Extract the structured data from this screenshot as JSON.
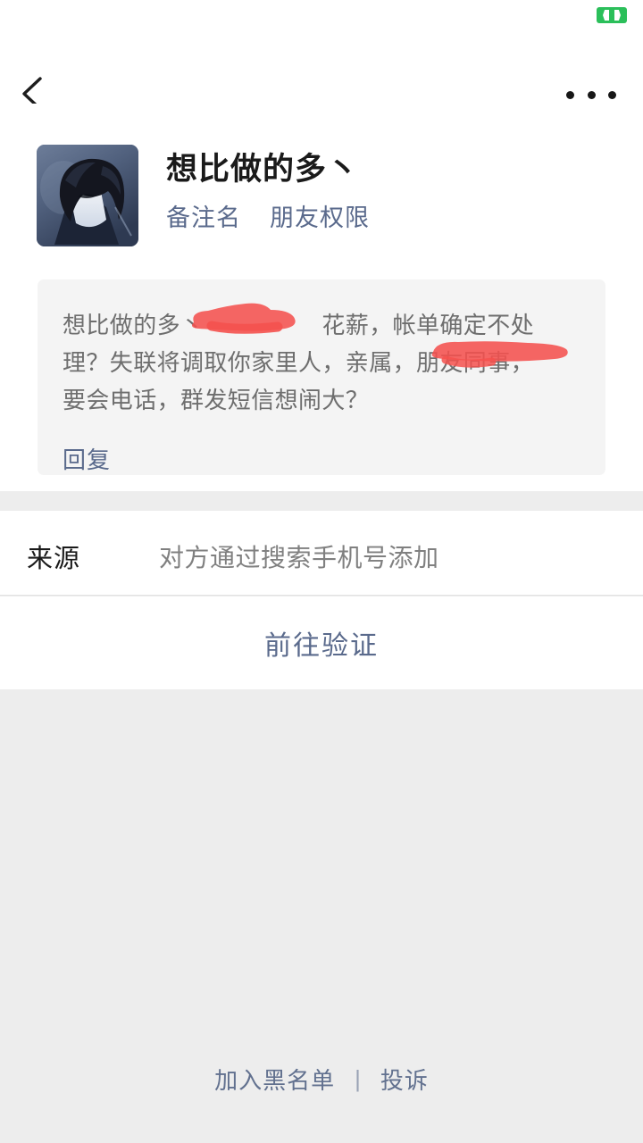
{
  "statusbar": {
    "battery_icon": "battery-charging-icon",
    "battery_color": "#2bbf5a"
  },
  "navbar": {
    "back_icon": "chevron-left-icon",
    "more_icon": "more-horizontal-icon"
  },
  "profile": {
    "avatar_icon": "anime-character-avatar",
    "name": "想比做的多丶",
    "links": [
      {
        "label": "备注名",
        "name": "remark-name-link"
      },
      {
        "label": "朋友权限",
        "name": "friend-permission-link"
      }
    ]
  },
  "message_card": {
    "text": "想比做的多丶　　　　　花薪，帐单确定不处理？失联将调取你家里人，亲属，朋友同事，　　　　　要会电话，群发短信想闹大？",
    "reply_label": "回复",
    "redaction_color": "#f4514e"
  },
  "source": {
    "label": "来源",
    "value": "对方通过搜索手机号添加"
  },
  "verify": {
    "label": "前往验证"
  },
  "footer": {
    "blacklist_label": "加入黑名单",
    "separator": "|",
    "complain_label": "投诉"
  },
  "colors": {
    "page_background": "#ededed",
    "card_background": "#f4f4f4",
    "link_blue": "#5a6a8c",
    "accent_green": "#2bbf5a"
  }
}
